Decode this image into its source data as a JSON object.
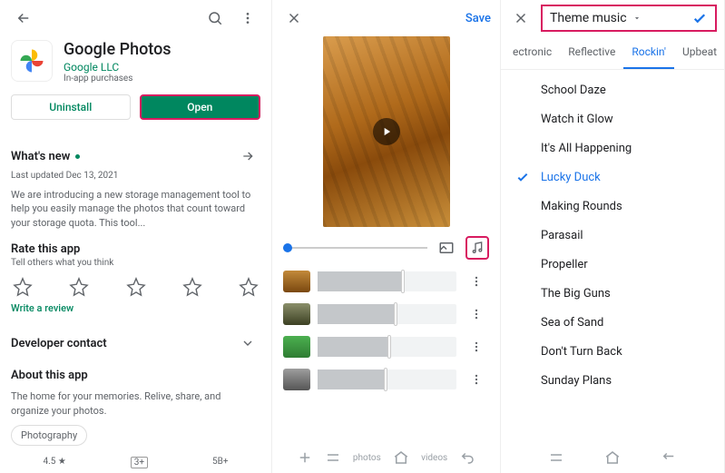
{
  "pane1": {
    "app_title": "Google Photos",
    "developer": "Google LLC",
    "purchase_note": "In-app purchases",
    "uninstall": "Uninstall",
    "open": "Open",
    "whatsnew_title": "What's new",
    "whatsnew_date": "Last updated Dec 13, 2021",
    "whatsnew_body": "We are introducing a new storage management tool to help you easily manage the photos that count toward your storage quota. This tool...",
    "rate_title": "Rate this app",
    "rate_sub": "Tell others what you think",
    "write_review": "Write a review",
    "dev_contact": "Developer contact",
    "about_title": "About this app",
    "about_body": "The home for your memories. Relive, share, and organize your photos.",
    "chip": "Photography",
    "rating": "4.5 ★",
    "content_rating": "3+",
    "downloads": "5B+"
  },
  "pane2": {
    "save": "Save",
    "bottom_label": "photos",
    "bottom_label2": "videos"
  },
  "pane3": {
    "dropdown": "Theme music",
    "tabs": [
      "ectronic",
      "Reflective",
      "Rockin'",
      "Upbeat"
    ],
    "active_tab": 2,
    "songs": [
      "School Daze",
      "Watch it Glow",
      "It's All Happening",
      "Lucky Duck",
      "Making Rounds",
      "Parasail",
      "Propeller",
      "The Big Guns",
      "Sea of Sand",
      "Don't Turn Back",
      "Sunday Plans"
    ],
    "selected_song": 3
  }
}
